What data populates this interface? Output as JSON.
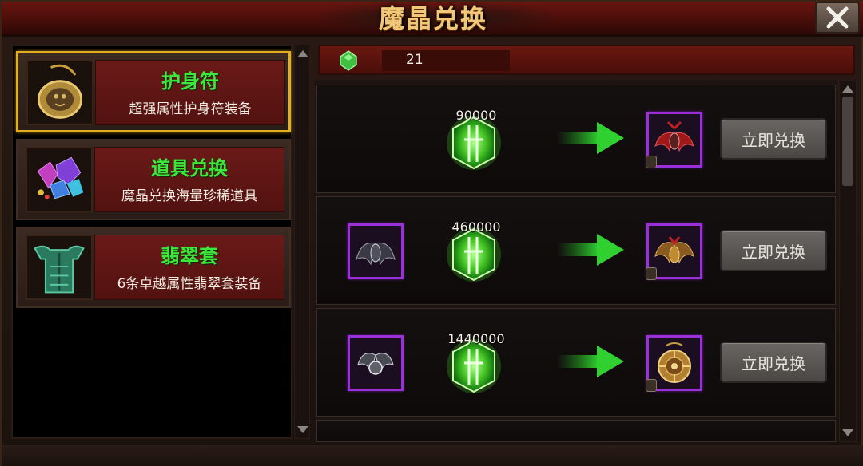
{
  "window": {
    "title": "魔晶兑换",
    "close_icon": "close-icon"
  },
  "currency": {
    "icon": "green-crystal-icon",
    "value": "21"
  },
  "categories": [
    {
      "title": "护身符",
      "desc": "超强属性护身符装备",
      "icon": "amulet-icon",
      "active": true
    },
    {
      "title": "道具兑换",
      "desc": "魔晶兑换海量珍稀道具",
      "icon": "gems-icon",
      "active": false
    },
    {
      "title": "翡翠套",
      "desc": "6条卓越属性翡翠套装备",
      "icon": "jade-armor-icon",
      "active": false
    }
  ],
  "exchanges": [
    {
      "input_item": null,
      "cost": "90000",
      "output_item": "red-demon-wings-icon",
      "button": "立即兑换"
    },
    {
      "input_item": "dark-wings-icon",
      "cost": "460000",
      "output_item": "bronze-wings-icon",
      "button": "立即兑换"
    },
    {
      "input_item": "silver-wings-icon",
      "cost": "1440000",
      "output_item": "gold-amulet-icon",
      "button": "立即兑换"
    }
  ],
  "colors": {
    "accent_green": "#3ce83c",
    "active_border": "#e0b020",
    "item_border": "#9a30d8",
    "title_gold": "#f0c878"
  }
}
